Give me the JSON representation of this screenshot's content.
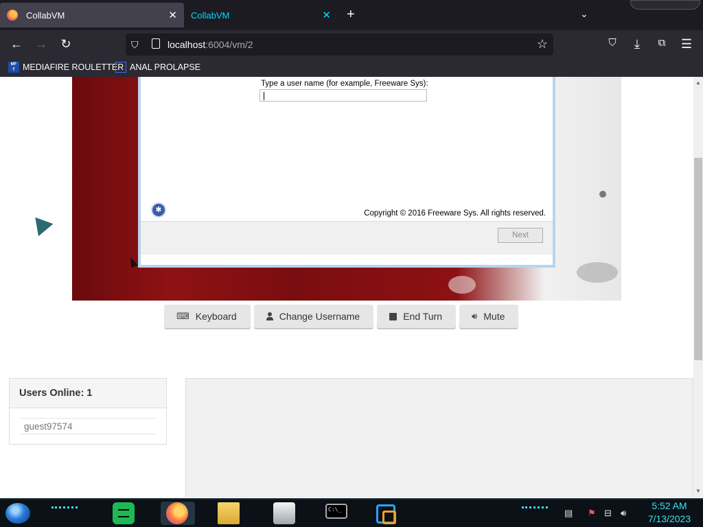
{
  "browser": {
    "tabs": [
      {
        "title": "CollabVM",
        "close": "✕"
      },
      {
        "title": "CollabVM",
        "close": "✕"
      }
    ],
    "new_tab": "+",
    "tab_list": "⌄",
    "url_host": "localhost",
    "url_path": ":6004/vm/2",
    "bookmarks": [
      {
        "label": "MEDIAFIRE ROULETTER",
        "icon": "mediafire-icon"
      },
      {
        "label": "ANAL PROLAPSE",
        "icon": "sigma-icon"
      }
    ]
  },
  "vm": {
    "dialog": {
      "prompt": "Type a user name (for example, Freeware Sys):",
      "username_value": "",
      "copyright": "Copyright © 2016 Freeware Sys. All rights reserved.",
      "next_label": "Next"
    }
  },
  "controls": {
    "keyboard": "Keyboard",
    "change_username": "Change Username",
    "end_turn": "End Turn",
    "mute": "Mute"
  },
  "users": {
    "heading": "Users Online: 1",
    "list": [
      "guest97574"
    ]
  },
  "taskbar": {
    "time": "5:52 AM",
    "date": "7/13/2023",
    "cmd_text": "C:\\_"
  },
  "colors": {
    "accent": "#3de0f0",
    "tab_active_text": "#00ddff",
    "browser_bg": "#2b2a33"
  }
}
